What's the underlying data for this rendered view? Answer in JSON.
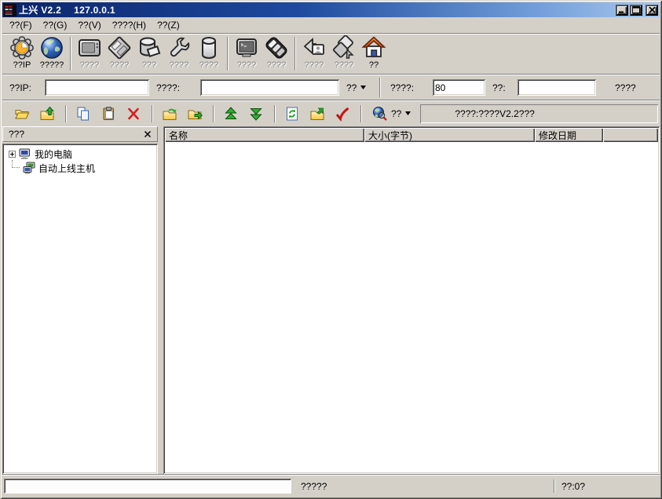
{
  "colors": {
    "face": "#d4d0c8",
    "titlebar_start": "#0b246b",
    "titlebar_end": "#a8c8ee",
    "folder_yellow": "#fbd050",
    "arrow_green": "#2fae2f",
    "delete_red": "#d42020",
    "roof_orange": "#e8683a"
  },
  "window": {
    "icon": "app-icon",
    "title_app": "上兴 V2.2",
    "title_host": "127.0.0.1",
    "controls": [
      {
        "icon": "minimize-icon"
      },
      {
        "icon": "maximize-icon"
      },
      {
        "icon": "close-icon"
      }
    ]
  },
  "menu_bar": {
    "items": [
      {
        "label": "??(F)"
      },
      {
        "label": "??(G)"
      },
      {
        "label": "??(V)"
      },
      {
        "label": "????(H)"
      },
      {
        "label": "??(Z)"
      }
    ]
  },
  "toolbar_main": {
    "buttons": [
      {
        "label": "??IP",
        "icon": "gear-icon",
        "enabled": true
      },
      {
        "label": "?????",
        "icon": "globe-icon",
        "enabled": true
      },
      {
        "label": "????",
        "icon": "monitor-icon",
        "enabled": false
      },
      {
        "label": "????",
        "icon": "floppy-icon",
        "enabled": false
      },
      {
        "label": "???",
        "icon": "drum-page-icon",
        "enabled": false
      },
      {
        "label": "????",
        "icon": "wrench-icon",
        "enabled": false
      },
      {
        "label": "????",
        "icon": "cylinder-icon",
        "enabled": false
      },
      {
        "label": "????",
        "icon": "terminal-icon",
        "enabled": false
      },
      {
        "label": "????",
        "icon": "keyboard-icon",
        "enabled": false
      },
      {
        "label": "????",
        "icon": "photo-back-icon",
        "enabled": false
      },
      {
        "label": "????",
        "icon": "diamonds-icon",
        "enabled": false
      },
      {
        "label": "??",
        "icon": "home-icon",
        "enabled": true
      }
    ]
  },
  "address_bar": {
    "ip_label": "??IP:",
    "ip_value": "",
    "host_label": "????:",
    "host_value": "",
    "mode_button_label": "??",
    "port_label": "????:",
    "port_value": "80",
    "pass_label": "??:",
    "pass_value": "",
    "action_label": "????"
  },
  "toolbar_file": {
    "buttons": [
      {
        "icon": "folder-open-icon"
      },
      {
        "icon": "folder-up-icon"
      },
      {
        "icon": "copy-icon"
      },
      {
        "icon": "paste-icon"
      },
      {
        "icon": "delete-icon"
      },
      {
        "icon": "folder-upload-icon"
      },
      {
        "icon": "folder-move-icon"
      },
      {
        "icon": "chevrons-up-icon"
      },
      {
        "icon": "chevrons-down-icon"
      },
      {
        "icon": "refresh-icon"
      },
      {
        "icon": "folder-go-icon"
      },
      {
        "icon": "check-icon"
      },
      {
        "icon": "search-globe-icon"
      }
    ],
    "search_button_label": "??",
    "status_text": "????:????V2.2???"
  },
  "sidebar": {
    "title": "???",
    "items": [
      {
        "icon": "my-computer-icon",
        "label": "我的电脑",
        "expandable": true
      },
      {
        "icon": "online-hosts-icon",
        "label": "自动上线主机",
        "expandable": false
      }
    ]
  },
  "file_list": {
    "columns": [
      {
        "label": "名称"
      },
      {
        "label": "大小(字节)"
      },
      {
        "label": "修改日期"
      },
      {
        "label": ""
      }
    ],
    "rows": []
  },
  "status_bar": {
    "progress_value": "",
    "message": "?????",
    "counter": "??:0?"
  }
}
